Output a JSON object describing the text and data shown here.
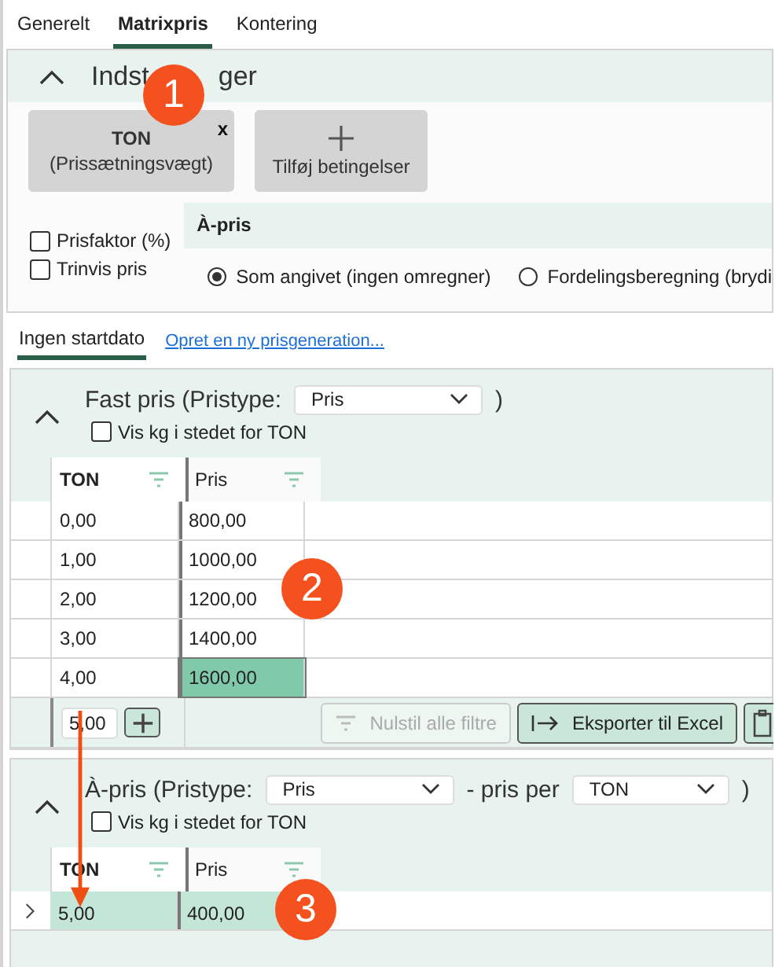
{
  "tabs": [
    {
      "label": "Generelt",
      "selected": false
    },
    {
      "label": "Matrixpris",
      "selected": true
    },
    {
      "label": "Kontering",
      "selected": false
    }
  ],
  "settings": {
    "title_parts": [
      "Indst",
      "ger"
    ],
    "expanded": true,
    "condition_buttons": [
      {
        "kind": "condition",
        "title": "TON",
        "subtitle": "(Prissætningsvægt)",
        "remove": "x"
      },
      {
        "kind": "add",
        "label": "Tilføj betingelser"
      }
    ],
    "checkboxes": [
      {
        "label": "Prisfaktor (%)",
        "checked": false
      },
      {
        "label": "Trinvis pris",
        "checked": false
      }
    ],
    "unit_price": {
      "title": "À-pris",
      "options": [
        {
          "label": "Som angivet (ingen omregner)",
          "selected": true
        },
        {
          "label": "Fordelingsberegning (brydi",
          "selected": false
        }
      ]
    }
  },
  "generation_tabs": [
    {
      "label": "Ingen startdato",
      "selected": true
    }
  ],
  "new_generation_link": "Opret en ny prisgeneration...",
  "fixed_price": {
    "expanded": true,
    "title": "Fast pris (Pristype:",
    "price_type": "Pris",
    "close": ")",
    "show_kg": {
      "label": "Vis kg i stedet for TON",
      "checked": false
    },
    "columns": [
      "TON",
      "Pris"
    ],
    "rows": [
      {
        "cells": [
          {
            "text": "0,00",
            "selected": false
          },
          {
            "text": "800,00",
            "selected": false
          }
        ]
      },
      {
        "cells": [
          {
            "text": "1,00",
            "selected": false
          },
          {
            "text": "1000,00",
            "selected": false
          }
        ]
      },
      {
        "cells": [
          {
            "text": "2,00",
            "selected": false
          },
          {
            "text": "1200,00",
            "selected": false
          }
        ]
      },
      {
        "cells": [
          {
            "text": "3,00",
            "selected": false
          },
          {
            "text": "1400,00",
            "selected": false
          }
        ]
      },
      {
        "cells": [
          {
            "text": "4,00",
            "selected": false
          },
          {
            "text": "1600,00",
            "selected": true
          }
        ]
      }
    ],
    "new_row_value": "5,00",
    "buttons": [
      {
        "kind": "filter",
        "label": "Nulstil alle filtre",
        "disabled": true
      },
      {
        "kind": "export",
        "label": "Eksporter til Excel",
        "disabled": false
      },
      {
        "kind": "clipboard",
        "disabled": false
      }
    ]
  },
  "unit_price_table": {
    "expanded": true,
    "title": "À-pris (Pristype:",
    "price_type": "Pris",
    "per_label": "- pris per",
    "per_unit": "TON",
    "close": ")",
    "show_kg": {
      "label": "Vis kg i stedet for TON",
      "checked": false
    },
    "columns": [
      "TON",
      "Pris"
    ],
    "rows": [
      {
        "selected": true,
        "cells": [
          "5,00",
          "400,00"
        ]
      }
    ]
  },
  "callouts": [
    "1",
    "2",
    "3"
  ]
}
